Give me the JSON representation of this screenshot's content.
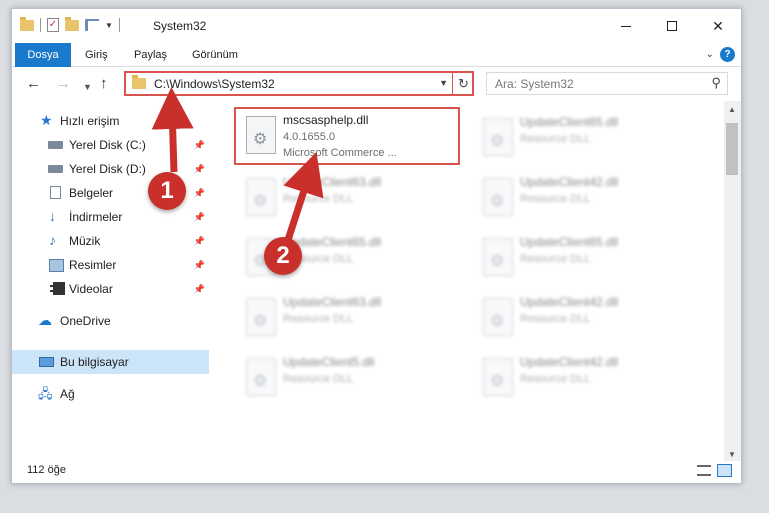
{
  "window": {
    "title": "System32",
    "minimize": "—",
    "maximize": "☐",
    "close": "✕"
  },
  "ribbon": {
    "tabs": [
      "Dosya",
      "Giriş",
      "Paylaş",
      "Görünüm"
    ],
    "help": "?"
  },
  "nav": {
    "address": "C:\\Windows\\System32",
    "search_placeholder": "Ara: System32"
  },
  "sidebar": {
    "items": [
      {
        "label": "Hızlı erişim",
        "icon": "star-icon"
      },
      {
        "label": "Yerel Disk (C:)",
        "icon": "drive-icon",
        "pinned": true
      },
      {
        "label": "Yerel Disk (D:)",
        "icon": "drive-icon",
        "pinned": true
      },
      {
        "label": "Belgeler",
        "icon": "documents-icon",
        "pinned": true
      },
      {
        "label": "İndirmeler",
        "icon": "download-icon",
        "pinned": true
      },
      {
        "label": "Müzik",
        "icon": "music-icon",
        "pinned": true
      },
      {
        "label": "Resimler",
        "icon": "pictures-icon",
        "pinned": true
      },
      {
        "label": "Videolar",
        "icon": "videos-icon",
        "pinned": true
      },
      {
        "label": "OneDrive",
        "icon": "onedrive-icon"
      },
      {
        "label": "Bu bilgisayar",
        "icon": "computer-icon",
        "selected": true
      },
      {
        "label": "Ağ",
        "icon": "network-icon"
      }
    ]
  },
  "files": {
    "highlighted": {
      "name": "mscsasphelp.dll",
      "version": "4.0.1655.0",
      "description": "Microsoft Commerce ..."
    },
    "others": [
      {
        "name": "UpdateClient65.dll",
        "type": "Resource DLL"
      },
      {
        "name": "UpdateClient63.dll",
        "type": "Resource DLL"
      },
      {
        "name": "UpdateClient42.dll",
        "type": "Resource DLL"
      },
      {
        "name": "UpdateClient65.dll",
        "type": "Resource DLL"
      },
      {
        "name": "UpdateClient65.dll",
        "type": "Resource DLL"
      },
      {
        "name": "UpdateClient63.dll",
        "type": "Resource DLL"
      },
      {
        "name": "UpdateClient42.dll",
        "type": "Resource DLL"
      },
      {
        "name": "UpdateClient5.dll",
        "type": "Resource DLL"
      },
      {
        "name": "UpdateClient42.dll",
        "type": "Resource DLL"
      }
    ]
  },
  "status": {
    "item_count": "112 öğe"
  },
  "annotations": {
    "step1": "1",
    "step2": "2",
    "color": "#c9302c"
  }
}
